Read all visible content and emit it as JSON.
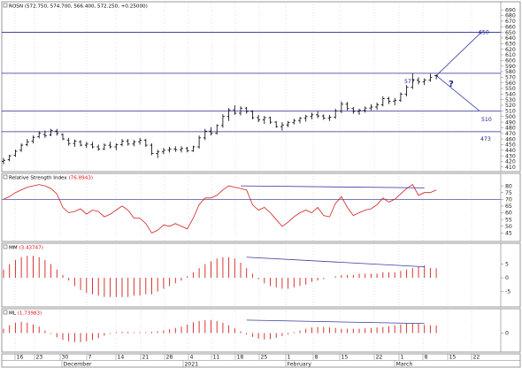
{
  "colors": {
    "price": "#000000",
    "level": "#2a2a9a",
    "annotation": "#1a1a8c",
    "oscillator": "#d22020",
    "trend": "#3a3aa0",
    "grid": "#c8c8c8",
    "panel_border": "#7f7f7f"
  },
  "panels": {
    "price": {
      "title_name": "ROSN",
      "title_values": "(572.750, 574.700, 566.400, 572.250, +0.25000)",
      "y_ticks": [
        "690",
        "680",
        "670",
        "660",
        "650",
        "640",
        "630",
        "620",
        "610",
        "600",
        "590",
        "580",
        "570",
        "560",
        "550",
        "540",
        "530",
        "520",
        "510",
        "500",
        "490",
        "480",
        "470",
        "460",
        "450",
        "440",
        "430",
        "420",
        "410"
      ],
      "labels": {
        "target_up": "650",
        "target_down": "510",
        "support": "473",
        "last_high": "577",
        "question": "?"
      }
    },
    "rsi": {
      "title_name": "Relative Strength Index",
      "title_value": "(76.8943)",
      "y_ticks": [
        "80",
        "75",
        "70",
        "65",
        "60",
        "55",
        "50",
        "45"
      ]
    },
    "mm": {
      "title_name": "MM",
      "title_value": "(3.43747)",
      "y_ticks": [
        "5",
        "0",
        "-5"
      ]
    },
    "ml": {
      "title_name": "ML",
      "title_value": "(1.73983)",
      "y_ticks": [
        "0"
      ]
    }
  },
  "x_axis": {
    "day_labels": [
      "16",
      "23",
      "30",
      "7",
      "14",
      "21",
      "28",
      "4",
      "11",
      "18",
      "25",
      "1",
      "8",
      "15",
      "22",
      "1",
      "8",
      "15",
      "22"
    ],
    "month_labels": [
      "December",
      "2021",
      "February",
      "March"
    ]
  },
  "chart_data": [
    {
      "type": "ohlc",
      "title": "ROSN (572.750, 574.700, 566.400, 572.250, +0.25000)",
      "ylim": [
        405,
        695
      ],
      "horizontal_levels": [
        650,
        577,
        510,
        473
      ],
      "projection": {
        "from_close": 573,
        "up_target": 650,
        "down_target": 510
      },
      "bars": [
        {
          "o": 420,
          "h": 426,
          "l": 415,
          "c": 422
        },
        {
          "o": 423,
          "h": 432,
          "l": 420,
          "c": 430
        },
        {
          "o": 431,
          "h": 441,
          "l": 428,
          "c": 438
        },
        {
          "o": 440,
          "h": 452,
          "l": 437,
          "c": 449
        },
        {
          "o": 450,
          "h": 460,
          "l": 447,
          "c": 455
        },
        {
          "o": 456,
          "h": 466,
          "l": 452,
          "c": 463
        },
        {
          "o": 464,
          "h": 474,
          "l": 461,
          "c": 470
        },
        {
          "o": 468,
          "h": 475,
          "l": 462,
          "c": 466
        },
        {
          "o": 467,
          "h": 478,
          "l": 465,
          "c": 475
        },
        {
          "o": 474,
          "h": 478,
          "l": 466,
          "c": 470
        },
        {
          "o": 468,
          "h": 470,
          "l": 458,
          "c": 460
        },
        {
          "o": 458,
          "h": 462,
          "l": 448,
          "c": 452
        },
        {
          "o": 452,
          "h": 459,
          "l": 446,
          "c": 456
        },
        {
          "o": 455,
          "h": 458,
          "l": 447,
          "c": 449
        },
        {
          "o": 449,
          "h": 455,
          "l": 444,
          "c": 451
        },
        {
          "o": 450,
          "h": 455,
          "l": 443,
          "c": 446
        },
        {
          "o": 446,
          "h": 450,
          "l": 439,
          "c": 442
        },
        {
          "o": 442,
          "h": 452,
          "l": 440,
          "c": 449
        },
        {
          "o": 449,
          "h": 455,
          "l": 443,
          "c": 446
        },
        {
          "o": 446,
          "h": 452,
          "l": 440,
          "c": 450
        },
        {
          "o": 450,
          "h": 460,
          "l": 447,
          "c": 456
        },
        {
          "o": 456,
          "h": 460,
          "l": 448,
          "c": 451
        },
        {
          "o": 451,
          "h": 458,
          "l": 447,
          "c": 455
        },
        {
          "o": 455,
          "h": 462,
          "l": 450,
          "c": 458
        },
        {
          "o": 458,
          "h": 460,
          "l": 446,
          "c": 449
        },
        {
          "o": 449,
          "h": 452,
          "l": 431,
          "c": 434
        },
        {
          "o": 434,
          "h": 441,
          "l": 426,
          "c": 437
        },
        {
          "o": 437,
          "h": 444,
          "l": 433,
          "c": 440
        },
        {
          "o": 440,
          "h": 446,
          "l": 436,
          "c": 442
        },
        {
          "o": 442,
          "h": 447,
          "l": 437,
          "c": 441
        },
        {
          "o": 441,
          "h": 447,
          "l": 436,
          "c": 443
        },
        {
          "o": 443,
          "h": 446,
          "l": 436,
          "c": 439
        },
        {
          "o": 439,
          "h": 448,
          "l": 437,
          "c": 446
        },
        {
          "o": 446,
          "h": 466,
          "l": 443,
          "c": 462
        },
        {
          "o": 462,
          "h": 478,
          "l": 458,
          "c": 474
        },
        {
          "o": 474,
          "h": 481,
          "l": 466,
          "c": 470
        },
        {
          "o": 470,
          "h": 486,
          "l": 468,
          "c": 484
        },
        {
          "o": 484,
          "h": 504,
          "l": 480,
          "c": 500
        },
        {
          "o": 500,
          "h": 515,
          "l": 492,
          "c": 512
        },
        {
          "o": 512,
          "h": 520,
          "l": 503,
          "c": 506
        },
        {
          "o": 506,
          "h": 518,
          "l": 502,
          "c": 515
        },
        {
          "o": 515,
          "h": 517,
          "l": 505,
          "c": 509
        },
        {
          "o": 509,
          "h": 511,
          "l": 495,
          "c": 498
        },
        {
          "o": 498,
          "h": 503,
          "l": 490,
          "c": 494
        },
        {
          "o": 494,
          "h": 501,
          "l": 487,
          "c": 498
        },
        {
          "o": 498,
          "h": 500,
          "l": 487,
          "c": 490
        },
        {
          "o": 490,
          "h": 492,
          "l": 480,
          "c": 482
        },
        {
          "o": 482,
          "h": 490,
          "l": 475,
          "c": 485
        },
        {
          "o": 485,
          "h": 492,
          "l": 481,
          "c": 489
        },
        {
          "o": 489,
          "h": 496,
          "l": 486,
          "c": 493
        },
        {
          "o": 493,
          "h": 499,
          "l": 488,
          "c": 497
        },
        {
          "o": 497,
          "h": 503,
          "l": 491,
          "c": 500
        },
        {
          "o": 500,
          "h": 507,
          "l": 495,
          "c": 503
        },
        {
          "o": 503,
          "h": 509,
          "l": 497,
          "c": 501
        },
        {
          "o": 501,
          "h": 504,
          "l": 494,
          "c": 497
        },
        {
          "o": 497,
          "h": 503,
          "l": 492,
          "c": 499
        },
        {
          "o": 499,
          "h": 514,
          "l": 496,
          "c": 510
        },
        {
          "o": 510,
          "h": 527,
          "l": 506,
          "c": 522
        },
        {
          "o": 522,
          "h": 526,
          "l": 511,
          "c": 514
        },
        {
          "o": 514,
          "h": 517,
          "l": 505,
          "c": 509
        },
        {
          "o": 509,
          "h": 514,
          "l": 503,
          "c": 511
        },
        {
          "o": 511,
          "h": 518,
          "l": 507,
          "c": 515
        },
        {
          "o": 515,
          "h": 522,
          "l": 511,
          "c": 517
        },
        {
          "o": 517,
          "h": 525,
          "l": 512,
          "c": 521
        },
        {
          "o": 521,
          "h": 536,
          "l": 518,
          "c": 532
        },
        {
          "o": 532,
          "h": 535,
          "l": 522,
          "c": 527
        },
        {
          "o": 527,
          "h": 533,
          "l": 520,
          "c": 529
        },
        {
          "o": 529,
          "h": 543,
          "l": 526,
          "c": 540
        },
        {
          "o": 540,
          "h": 556,
          "l": 536,
          "c": 552
        },
        {
          "o": 552,
          "h": 577,
          "l": 549,
          "c": 565
        },
        {
          "o": 565,
          "h": 570,
          "l": 557,
          "c": 562
        },
        {
          "o": 562,
          "h": 568,
          "l": 556,
          "c": 565
        },
        {
          "o": 565,
          "h": 576,
          "l": 562,
          "c": 570
        },
        {
          "o": 572.75,
          "h": 574.7,
          "l": 566.4,
          "c": 572.25
        }
      ]
    },
    {
      "type": "line",
      "title": "Relative Strength Index (76.8943)",
      "ylim": [
        40,
        84
      ],
      "horizontal_levels": [
        70
      ],
      "values": [
        70,
        72,
        75,
        77,
        79,
        80,
        81,
        80,
        78,
        74,
        64,
        60,
        61,
        63,
        59,
        62,
        61,
        57,
        59,
        62,
        65,
        62,
        56,
        56,
        52,
        45,
        47,
        51,
        50,
        52,
        50,
        48,
        56,
        66,
        71,
        71,
        73,
        77,
        80,
        79,
        78,
        77,
        66,
        62,
        64,
        60,
        55,
        50,
        53,
        57,
        60,
        62,
        60,
        64,
        58,
        57,
        67,
        72,
        64,
        58,
        60,
        62,
        63,
        66,
        71,
        68,
        70,
        74,
        78,
        81,
        73,
        75,
        75,
        76.8943
      ],
      "trendline": {
        "start_index": 40,
        "end_index": 71,
        "start_value": 80,
        "end_value": 78.5
      }
    },
    {
      "type": "bar",
      "title": "MM (3.43747)",
      "ylim": [
        -10,
        10
      ],
      "values": [
        3,
        5,
        6.5,
        7.5,
        8,
        8,
        7.5,
        6.5,
        5,
        3,
        1,
        -1,
        -3,
        -4.5,
        -5.5,
        -6,
        -6.5,
        -7,
        -7,
        -7,
        -7,
        -7,
        -6.5,
        -6.5,
        -6,
        -6,
        -5,
        -4,
        -3,
        -2,
        -1,
        0.5,
        2,
        3.5,
        5,
        6,
        7,
        7.5,
        7.5,
        7,
        5.5,
        3.5,
        1.5,
        -0.5,
        -2,
        -3,
        -3.5,
        -4,
        -4,
        -3.5,
        -3,
        -2.5,
        -1.5,
        -1,
        -0.5,
        0,
        0.5,
        1,
        1,
        1,
        1.5,
        1.5,
        1.5,
        1.5,
        2,
        2,
        2,
        2.5,
        3,
        3.5,
        4,
        4.5,
        3.6,
        3.43747
      ],
      "trendline": {
        "start_index": 41,
        "end_index": 71,
        "start_value": 7.5,
        "end_value": 4
      }
    },
    {
      "type": "bar",
      "title": "ML (1.73983)",
      "ylim": [
        -4,
        4
      ],
      "values": [
        1,
        1.8,
        2.4,
        2.6,
        2.4,
        2,
        1.5,
        0.6,
        -0.2,
        -1,
        -1.6,
        -1.9,
        -2.1,
        -2.1,
        -1.9,
        -1.6,
        -1.2,
        -0.6,
        -0.2,
        0.2,
        0.3,
        0.3,
        0.2,
        0.2,
        0.2,
        0.3,
        0.4,
        0.6,
        0.9,
        1.2,
        1.5,
        2,
        2.5,
        2.8,
        3,
        3,
        2.8,
        2.4,
        1.8,
        1.1,
        0.4,
        -0.3,
        -0.9,
        -1.3,
        -1.5,
        -1.4,
        -1.1,
        -0.7,
        -0.3,
        0.2,
        0.6,
        1,
        1.3,
        1.4,
        1.4,
        1.3,
        1.2,
        1,
        1,
        1,
        1,
        1.1,
        1.2,
        1.3,
        1.4,
        1.6,
        1.8,
        2,
        2.2,
        2.3,
        2.2,
        1.9,
        1.8,
        1.73983
      ],
      "trendline": {
        "start_index": 41,
        "end_index": 71,
        "start_value": 3,
        "end_value": 2.2
      }
    }
  ]
}
